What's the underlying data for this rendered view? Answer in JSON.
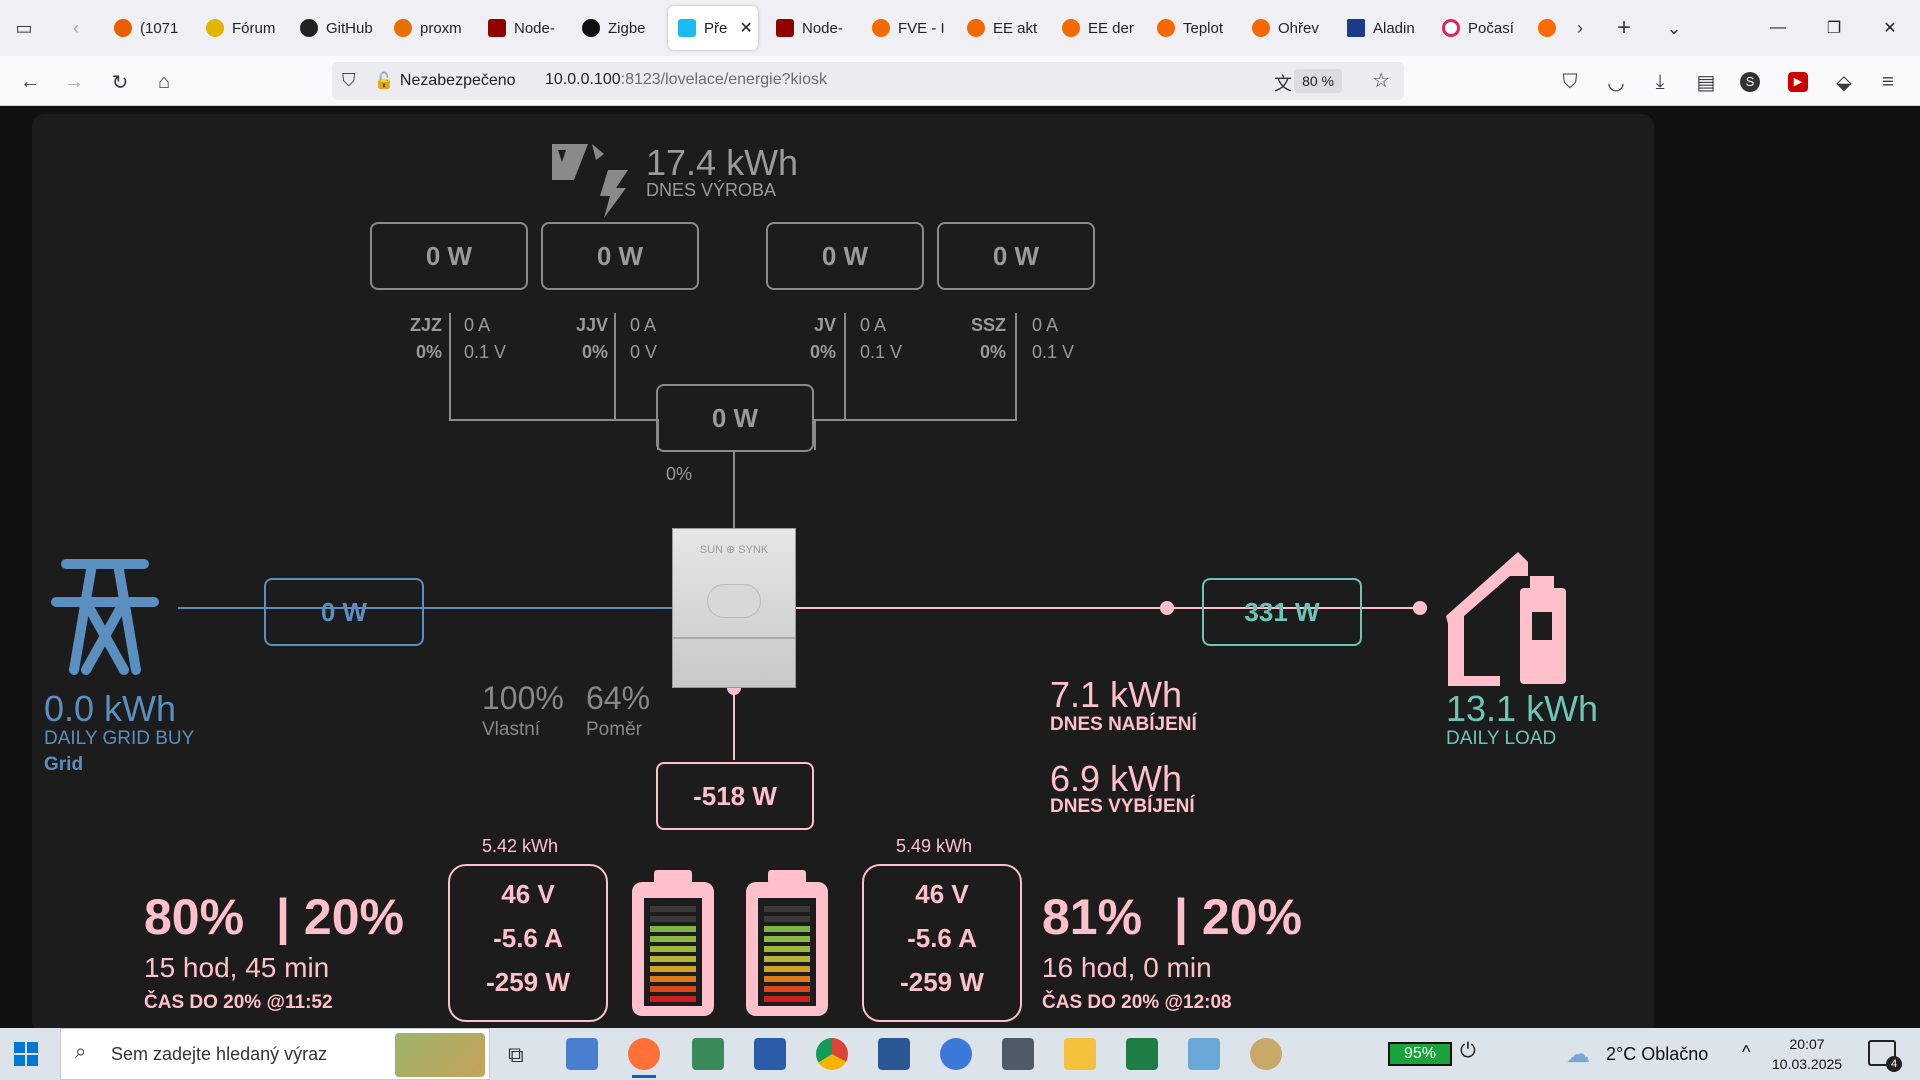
{
  "browser": {
    "tabs": [
      {
        "label": "(1071",
        "color": "#e66000"
      },
      {
        "label": "Fórum",
        "color": "#e1b500"
      },
      {
        "label": "GitHub",
        "color": "#222222"
      },
      {
        "label": "proxm",
        "color": "#e57000"
      },
      {
        "label": "Node-",
        "color": "#8f0000"
      },
      {
        "label": "Zigbe",
        "color": "#111111"
      },
      {
        "label": "Pře",
        "color": "#18bcf2"
      },
      {
        "label": "Node-",
        "color": "#8f0000"
      },
      {
        "label": "FVE - I",
        "color": "#f46800"
      },
      {
        "label": "EE akt",
        "color": "#f46800"
      },
      {
        "label": "EE der",
        "color": "#f46800"
      },
      {
        "label": "Teplot",
        "color": "#f46800"
      },
      {
        "label": "Ohřev",
        "color": "#f46800"
      },
      {
        "label": "Aladin",
        "color": "#1d3a8a"
      },
      {
        "label": "Počasí",
        "color": "#e0245e"
      }
    ],
    "security_label": "Nezabezpečeno",
    "url_host": "10.0.0.100",
    "url_path": ":8123/lovelace/energie?kiosk",
    "zoom": "80 %"
  },
  "energy": {
    "solar": {
      "today": "17.4 kWh",
      "today_label": "DNES VÝROBA"
    },
    "pv_strings": [
      {
        "power": "0 W",
        "name": "ZJZ",
        "percent": "0%",
        "current": "0 A",
        "voltage": "0.1 V"
      },
      {
        "power": "0 W",
        "name": "JJV",
        "percent": "0%",
        "current": "0 A",
        "voltage": "0 V"
      },
      {
        "power": "0 W",
        "name": "JV",
        "percent": "0%",
        "current": "0 A",
        "voltage": "0.1 V"
      },
      {
        "power": "0 W",
        "name": "SSZ",
        "percent": "0%",
        "current": "0 A",
        "voltage": "0.1 V"
      }
    ],
    "pv_total": {
      "power": "0 W",
      "percent": "0%"
    },
    "inverter": {
      "brand": "SUN ⊕ SYNK"
    },
    "grid": {
      "power": "0 W",
      "daily": "0.0 kWh",
      "daily_label": "DAILY GRID BUY",
      "name": "Grid"
    },
    "self_use": {
      "value": "100%",
      "label": "Vlastní"
    },
    "ratio": {
      "value": "64%",
      "label": "Poměr"
    },
    "load": {
      "power": "331 W",
      "daily": "13.1 kWh",
      "daily_label": "DAILY LOAD"
    },
    "charge": {
      "value": "7.1 kWh",
      "label": "DNES NABÍJENÍ"
    },
    "discharge": {
      "value": "6.9 kWh",
      "label": "DNES VYBÍJENÍ"
    },
    "battery_power": "-518 W",
    "battery1": {
      "soc": "80%",
      "min": "| 20%",
      "time_left": "15 hod, 45 min",
      "eta": "ČAS DO 20% @11:52",
      "energy": "5.42 kWh",
      "voltage": "46 V",
      "current": "-5.6 A",
      "power": "-259 W",
      "level": 0.8
    },
    "battery2": {
      "soc": "81%",
      "min": "| 20%",
      "time_left": "16 hod, 0 min",
      "eta": "ČAS DO 20% @12:08",
      "energy": "5.49 kWh",
      "voltage": "46 V",
      "current": "-5.6 A",
      "power": "-259 W",
      "level": 0.81
    }
  },
  "taskbar": {
    "search_placeholder": "Sem zadejte hledaný výraz",
    "battery": "95%",
    "weather": "2°C  Oblačno",
    "time": "20:07",
    "date": "10.03.2025",
    "notifications": "4"
  }
}
